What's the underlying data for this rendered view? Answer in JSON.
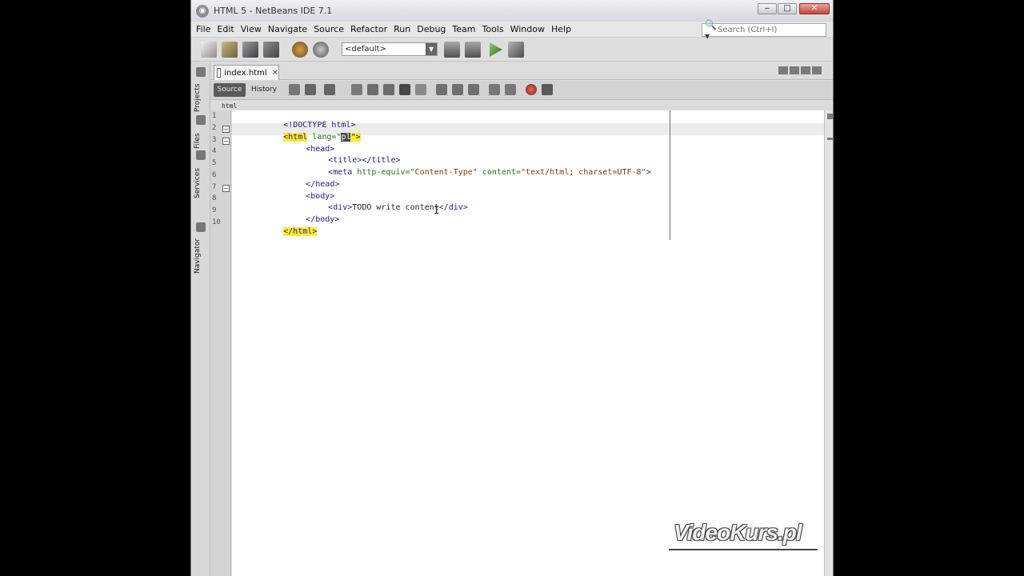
{
  "window": {
    "title": "HTML 5 - NetBeans IDE 7.1",
    "minimize": "‒",
    "maximize": "□",
    "close": "✕",
    "app_icon": "◉"
  },
  "menubar": {
    "items": [
      "File",
      "Edit",
      "View",
      "Navigate",
      "Source",
      "Refactor",
      "Run",
      "Debug",
      "Team",
      "Tools",
      "Window",
      "Help"
    ],
    "search_placeholder": "Search (Ctrl+I)",
    "search_icon_glyph": "🔍▾"
  },
  "toolbar": {
    "config_select": "<default>",
    "config_arrow": "▼",
    "icons": [
      "new-file-icon",
      "new-project-icon",
      "open-project-icon",
      "save-all-icon",
      "undo-icon",
      "redo-icon",
      "build-icon",
      "clean-build-icon",
      "run-icon",
      "debug-icon"
    ]
  },
  "side_panel": {
    "tabs": [
      "Projects",
      "Files",
      "Services",
      "Navigator"
    ]
  },
  "editor": {
    "tab_label": "index.html",
    "tab_close": "✕",
    "source_label": "Source",
    "history_label": "History",
    "breadcrumb": "html",
    "line_numbers": [
      "1",
      "2",
      "3",
      "4",
      "5",
      "6",
      "7",
      "8",
      "9",
      "10"
    ],
    "fold_glyph": "−",
    "code": {
      "line1": "<!DOCTYPE html>",
      "line2_tag_open": "<html",
      "line2_attr": " lang=\"",
      "line2_val": "pl",
      "line2_close": "\">",
      "line3": "<head>",
      "line4": "<title></title>",
      "line5_tag": "<meta",
      "line5_attr1": " http-equiv=",
      "line5_val1": "\"Content-Type\"",
      "line5_attr2": " content=",
      "line5_val2": "\"text/html; charset=UTF-8\"",
      "line5_end": ">",
      "line6": "</head>",
      "line7": "<body>",
      "line8_tag1": "<div>",
      "line8_text": "TODO write content",
      "line8_tag2": "</div>",
      "line9": "</body>",
      "line10": "</html>"
    },
    "cursor_glyph": "I"
  },
  "watermark": {
    "text": "VideoKurs.pl"
  },
  "colors": {
    "tag_highlight": "#ffea2e",
    "title_bar": "#e1e4e9",
    "editor_bg": "#ffffff"
  }
}
